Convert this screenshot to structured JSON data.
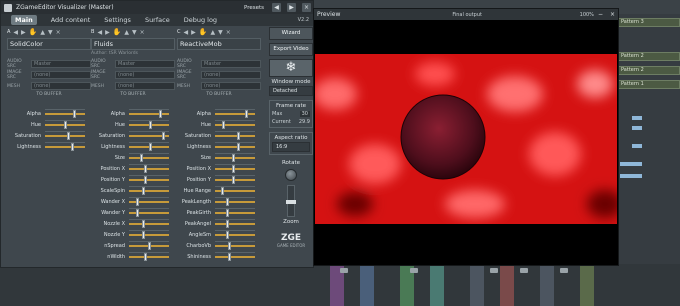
{
  "plugin": {
    "title": "ZGameEditor Visualizer (Master)",
    "presets_label": "Presets",
    "version": "V2.2",
    "tabs": [
      "Main",
      "Add content",
      "Settings",
      "Surface",
      "Debug log"
    ],
    "active_tab": "Main"
  },
  "columns": [
    {
      "letter": "A",
      "name": "SolidColor",
      "author": "",
      "audio_src": "Master",
      "image_src": "(none)",
      "mesh": "(none)",
      "to_buffer": "TO BUFFER",
      "params": [
        {
          "label": "Alpha",
          "value": 0.75
        },
        {
          "label": "Hue",
          "value": 0.5
        },
        {
          "label": "Saturation",
          "value": 0.6
        },
        {
          "label": "Lightness",
          "value": 0.7
        }
      ]
    },
    {
      "letter": "B",
      "name": "Fluids",
      "author": "Author: tSR Warlords",
      "audio_src": "Master",
      "image_src": "(none)",
      "mesh": "(none)",
      "to_buffer": "TO BUFFER",
      "params": [
        {
          "label": "Alpha",
          "value": 0.8
        },
        {
          "label": "Hue",
          "value": 0.55
        },
        {
          "label": "Saturation",
          "value": 0.9
        },
        {
          "label": "Lightness",
          "value": 0.55
        },
        {
          "label": "Size",
          "value": 0.3
        },
        {
          "label": "Position X",
          "value": 0.4
        },
        {
          "label": "Position Y",
          "value": 0.4
        },
        {
          "label": "ScaleSpin",
          "value": 0.35
        },
        {
          "label": "Wander X",
          "value": 0.2
        },
        {
          "label": "Wander Y",
          "value": 0.2
        },
        {
          "label": "Nozzle X",
          "value": 0.35
        },
        {
          "label": "Nozzle Y",
          "value": 0.35
        },
        {
          "label": "nSpread",
          "value": 0.5
        },
        {
          "label": "nWidth",
          "value": 0.4
        }
      ]
    },
    {
      "letter": "C",
      "name": "ReactiveMob",
      "author": "",
      "audio_src": "Master",
      "image_src": "(none)",
      "mesh": "(none)",
      "to_buffer": "TO BUFFER",
      "params": [
        {
          "label": "Alpha",
          "value": 0.8
        },
        {
          "label": "Hue",
          "value": 0.2
        },
        {
          "label": "Saturation",
          "value": 0.6
        },
        {
          "label": "Lightness",
          "value": 0.6
        },
        {
          "label": "Size",
          "value": 0.45
        },
        {
          "label": "Position X",
          "value": 0.45
        },
        {
          "label": "Position Y",
          "value": 0.45
        },
        {
          "label": "Hue Range",
          "value": 0.15
        },
        {
          "label": "PeakLength",
          "value": 0.3
        },
        {
          "label": "PeakGirth",
          "value": 0.3
        },
        {
          "label": "PeakAngel",
          "value": 0.3
        },
        {
          "label": "AngleSm",
          "value": 0.3
        },
        {
          "label": "CharboVb",
          "value": 0.35
        },
        {
          "label": "Shininess",
          "value": 0.35
        }
      ]
    }
  ],
  "row_labels": {
    "audio": "AUDIO SRC",
    "image": "IMAGE SRC",
    "mesh": "MESH"
  },
  "right_panel": {
    "wizard": "Wizard",
    "export_video": "Export Video",
    "window_mode_label": "Window mode",
    "window_mode_value": "Detached",
    "frame_rate_label": "Frame rate",
    "max_label": "Max",
    "max_value": "30",
    "current_label": "Current",
    "current_value": "29.9",
    "aspect_label": "Aspect ratio",
    "aspect_value": "16:9",
    "rotate_label": "Rotate",
    "zoom_label": "Zoom",
    "logo": "ZGE",
    "logo_sub": "GAME EDITOR"
  },
  "preview": {
    "title": "Preview",
    "output": "Final output",
    "zoom": "100%"
  },
  "playlist_clips": [
    "Pattern 3",
    "Pattern 2",
    "Pattern 2",
    "Pattern 1"
  ],
  "colors": {
    "accent_track": "#c69a3a",
    "render_red": "#e01818"
  }
}
